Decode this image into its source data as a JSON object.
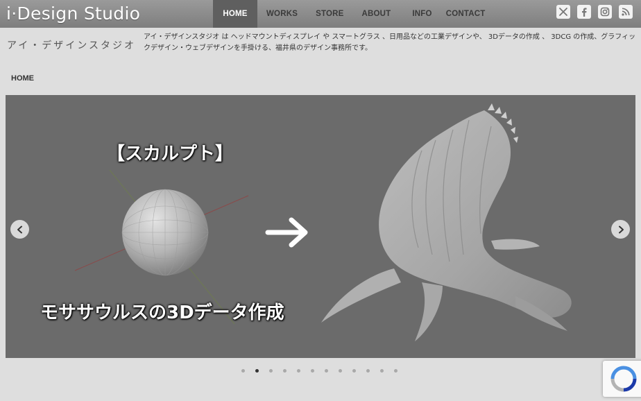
{
  "site": {
    "logo": "i·Design Studio",
    "kana_name": "アイ・デザインスタジオ",
    "description": "アイ・デザインスタジオ は ヘッドマウントディスプレイ や スマートグラス 、日用品などの工業デザインや、 3Dデータの作成 、 3DCG の作成、グラフィックデザイン・ウェブデザインを手掛ける、福井県のデザイン事務所です。"
  },
  "nav": {
    "items": [
      {
        "label": "HOME",
        "active": true
      },
      {
        "label": "WORKS",
        "active": false
      },
      {
        "label": "STORE",
        "active": false
      },
      {
        "label": "ABOUT",
        "active": false
      },
      {
        "label": "INFO",
        "active": false
      },
      {
        "label": "CONTACT",
        "active": false
      }
    ]
  },
  "social": [
    "x-icon",
    "facebook-icon",
    "instagram-icon",
    "rss-icon"
  ],
  "breadcrumb": "HOME",
  "slider": {
    "heading": "【スカルプト】",
    "caption": "モササウルスの3Dデータ作成",
    "dot_count": 12,
    "active_index": 1
  },
  "colors": {
    "topbar": "#8a8a8a",
    "nav_active": "#5f5f5f",
    "page_bg": "#dedede",
    "slide_bg": "#6b6b6b"
  }
}
